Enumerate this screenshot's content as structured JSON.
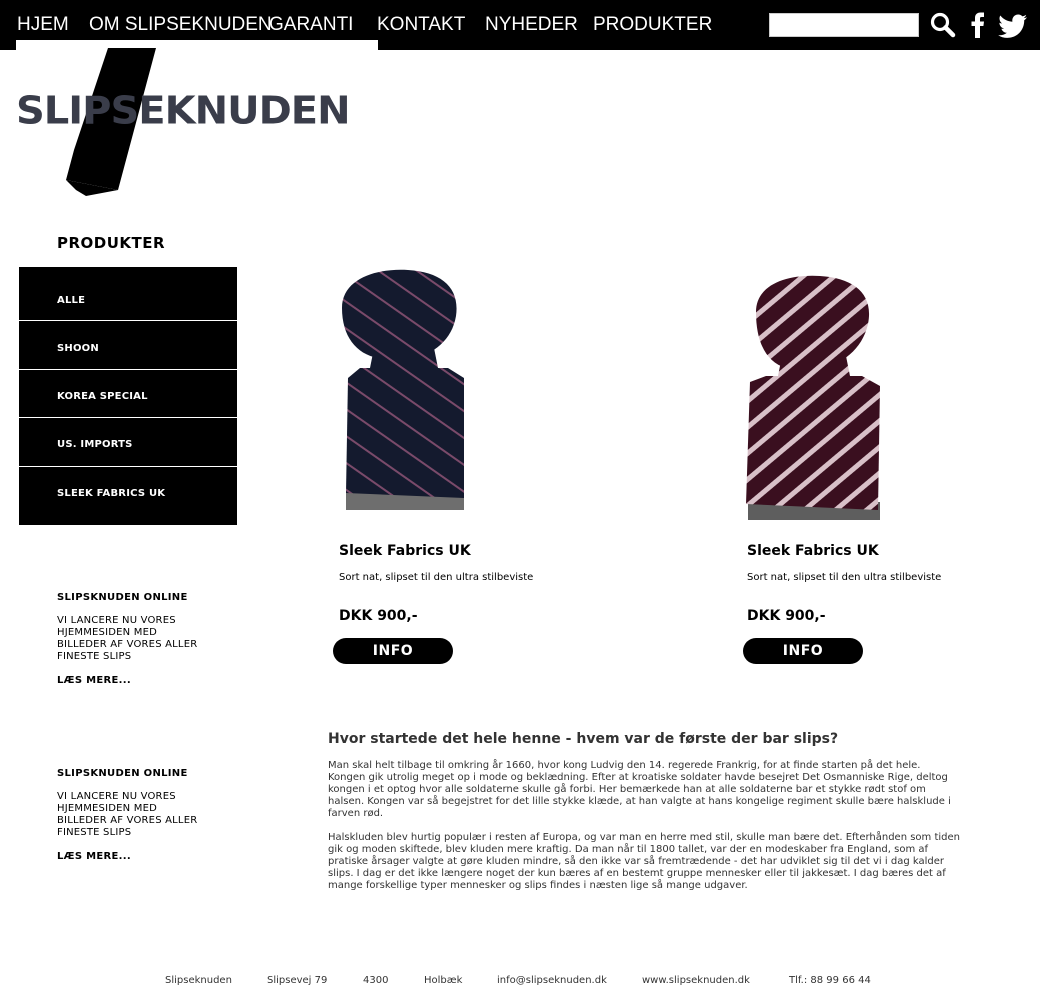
{
  "nav": {
    "items": [
      "HJEM",
      "OM SLIPSEKNUDEN",
      "GARANTI",
      "KONTAKT",
      "NYHEDER",
      "PRODUKTER"
    ],
    "search_placeholder": "",
    "facebook_icon": "facebook-icon",
    "twitter_icon": "twitter-icon",
    "search_icon": "search-icon"
  },
  "logo": {
    "text": "SLIPSEKNUDEN"
  },
  "sidebar": {
    "heading": "PRODUKTER",
    "categories": [
      "ALLE",
      "SHOON",
      "KOREA SPECIAL",
      "US. IMPORTS",
      "SLEEK FABRICS UK"
    ],
    "news": [
      {
        "title": "SLIPSKNUDEN ONLINE",
        "body": "VI LANCERE NU VORES\nHJEMMESIDEN MED\nBILLEDER AF VORES ALLER\nFINESTE SLIPS",
        "more": "LÆS MERE..."
      },
      {
        "title": "SLIPSKNUDEN ONLINE",
        "body": "VI LANCERE NU VORES\nHJEMMESIDEN MED\nBILLEDER AF VORES ALLER\nFINESTE SLIPS",
        "more": "LÆS MERE..."
      }
    ]
  },
  "products": [
    {
      "name": "Sleek Fabrics UK",
      "desc": "Sort nat, slipset til den ultra stilbeviste",
      "price": "DKK 900,-",
      "button": "INFO",
      "color": "#141a2e",
      "stripe": "#7a4a6a"
    },
    {
      "name": "Sleek Fabrics UK",
      "desc": "Sort nat, slipset til den ultra stilbeviste",
      "price": "DKK 900,-",
      "button": "INFO",
      "color": "#3a0f1f",
      "stripe": "#d8c0c8"
    }
  ],
  "article": {
    "title": "Hvor startede det hele henne - hvem var de første der bar slips?",
    "p1": "Man skal helt tilbage til omkring år 1660, hvor kong Ludvig den 14. regerede Frankrig, for at finde starten på det hele. Kongen gik utrolig meget op i mode og beklædning. Efter at kroatiske soldater havde besejret Det Osmanniske Rige, deltog kongen i et optog hvor alle soldaterne skulle gå forbi. Her bemærkede han at alle soldaterne bar et stykke rødt stof om halsen. Kongen var så begejstret for det lille stykke klæde, at han valgte at hans kongelige regiment skulle bære halsklude i farven rød.",
    "p2": "Halskluden blev hurtig populær i resten af Europa, og var man en herre med stil, skulle man bære det. Efterhånden som tiden gik og moden skiftede, blev kluden mere kraftig. Da man når til 1800 tallet, var der en modeskaber fra England, som af pratiske årsager valgte at gøre kluden mindre, så den ikke var så fremtrædende - det har udviklet sig til det vi i dag kalder slips. I dag er det ikke længere noget der kun bæres af en bestemt gruppe mennesker eller til jakkesæt. I dag bæres det af mange forskellige typer mennesker og slips findes i næsten lige så mange udgaver."
  },
  "footer": {
    "company": "Slipseknuden",
    "street": "Slipsevej 79",
    "zip": "4300",
    "city": "Holbæk",
    "email": "info@slipseknuden.dk",
    "web": "www.slipseknuden.dk",
    "phone": "Tlf.: 88 99 66 44"
  },
  "colors": {
    "nav_bg": "#000000",
    "menu_bg": "#000000",
    "text": "#333333"
  }
}
